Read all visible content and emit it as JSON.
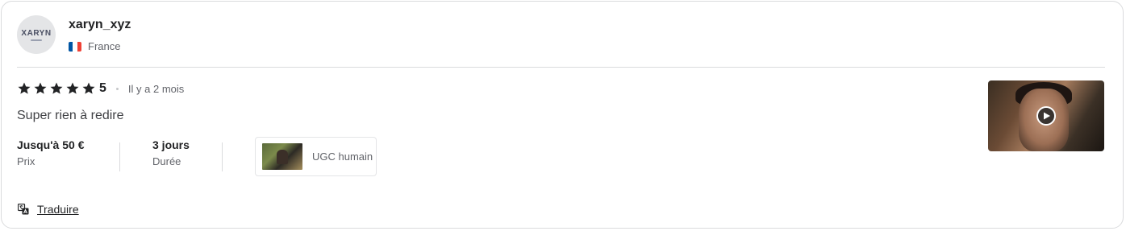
{
  "review": {
    "avatar_logo": "XARYN",
    "username": "xaryn_xyz",
    "country": "France",
    "rating": 5,
    "rating_label": "5",
    "time_ago": "Il y a 2 mois",
    "text": "Super rien à redire",
    "price": {
      "value": "Jusqu'à 50 €",
      "label": "Prix"
    },
    "duration": {
      "value": "3 jours",
      "label": "Durée"
    },
    "service": {
      "label": "UGC humain"
    },
    "translate_label": "Traduire"
  },
  "icons": {
    "star": "star-icon",
    "play": "play-icon",
    "translate": "translate-icon",
    "flag": "france-flag-icon"
  },
  "colors": {
    "star": "#222325",
    "flag_blue": "#0055a4",
    "flag_white": "#ffffff",
    "flag_red": "#ef4135"
  }
}
